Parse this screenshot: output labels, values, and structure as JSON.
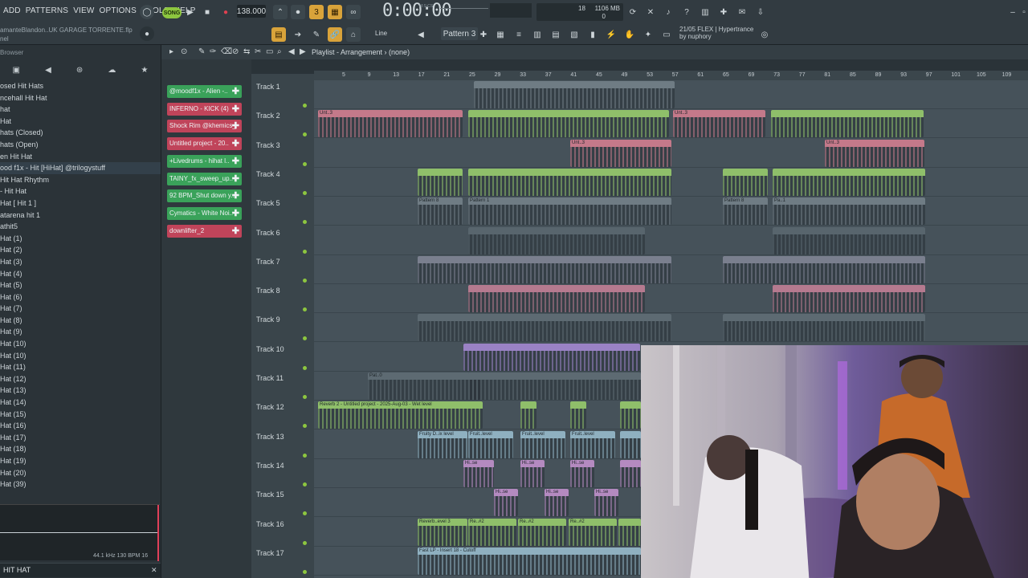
{
  "menu": [
    "ADD",
    "PATTERNS",
    "VIEW",
    "OPTIONS",
    "TOOLS",
    "HELP"
  ],
  "project": {
    "file_line": "amanteBlandon..UK GARAGE TORRENTE.flp",
    "sub_line": "nel"
  },
  "transport": {
    "mode_label": "SONG",
    "tempo": "138.000",
    "time": "0:00:00",
    "time_sub": "M:S:CS"
  },
  "cpu": {
    "voices": "18",
    "memory": "1106 MB",
    "extra": "0"
  },
  "toolbar2": {
    "snap_label": "Line",
    "pattern_label": "Pattern 3"
  },
  "flex": {
    "line1": "21/05  FLEX | Hypertrance",
    "line2": "by nuphory"
  },
  "browser": {
    "title": "Browser",
    "items": [
      "osed Hit Hats",
      "ncehall Hit Hat",
      " hat",
      " Hat",
      "hats (Closed)",
      "hats (Open)",
      "en Hit Hat",
      "ood f1x - Hit [HiHat] @trilogystuff",
      " Hit Hat Rhythm",
      "- Hit Hat",
      "Hat [ Hit 1 ]",
      "atarena hit 1",
      "athit5",
      "Hat (1)",
      "Hat (2)",
      "Hat (3)",
      "Hat (4)",
      "Hat (5)",
      "Hat (6)",
      "Hat (7)",
      "Hat (8)",
      "Hat (9)",
      "Hat (10)",
      "Hat (10)",
      "Hat (11)",
      "Hat (12)",
      "Hat (13)",
      "Hat (14)",
      "Hat (15)",
      "Hat (16)",
      "Hat (17)",
      "Hat (18)",
      "Hat (19)",
      "Hat (20)",
      "Hat (39)"
    ],
    "wave_info": "44.1 kHz 130 BPM 16",
    "search_text": "HIT HAT"
  },
  "playlist": {
    "title": "Playlist - Arrangement",
    "pattern": "(none)",
    "clips": [
      {
        "label": "@moodf1x - Alien -..",
        "color": "#3aa25a"
      },
      {
        "label": "INFERNO - KICK (4)",
        "color": "#c0445a"
      },
      {
        "label": "Shock Rim @khemics_",
        "color": "#c0445a"
      },
      {
        "label": "Untitled project - 20..",
        "color": "#c0445a"
      },
      {
        "label": "+Livedrums - hihat l..",
        "color": "#3aa25a"
      },
      {
        "label": "TAINY_fx_sweep_up..",
        "color": "#3aa25a"
      },
      {
        "label": "92 BPM_Shut down y..",
        "color": "#3aa25a"
      },
      {
        "label": "Cymatics - White Noi..",
        "color": "#3aa25a"
      },
      {
        "label": "downlifter_2",
        "color": "#c0445a"
      }
    ],
    "ruler": [
      "5",
      "9",
      "13",
      "17",
      "21",
      "25",
      "29",
      "33",
      "37",
      "41",
      "45",
      "49",
      "53",
      "57",
      "61",
      "65",
      "69",
      "73",
      "77",
      "81",
      "85",
      "89",
      "93",
      "97",
      "101",
      "105",
      "109"
    ],
    "tracks": [
      "Track 1",
      "Track 2",
      "Track 3",
      "Track 4",
      "Track 5",
      "Track 6",
      "Track 7",
      "Track 8",
      "Track 9",
      "Track 10",
      "Track 11",
      "Track 12",
      "Track 13",
      "Track 14",
      "Track 15",
      "Track 16",
      "Track 17"
    ],
    "clip_texts": {
      "unt": "Unt..3",
      "pattern8": "Pattern 8",
      "pattern1": "Pattern 1",
      "pa1": "Pa..1",
      "pat": "Pat..0",
      "reverb": "Reverb 2 - Untitled project - 2025-Aug-03 - Wet level",
      "fruity": "Fruity D..ix level",
      "fruit": "Fruit..level",
      "hise": "Hi..se",
      "reverb_evel": "Reverb..evel 3",
      "re": "Re..#2",
      "fastlp": "Fast LP - Insert 18 - Cutoff"
    }
  }
}
